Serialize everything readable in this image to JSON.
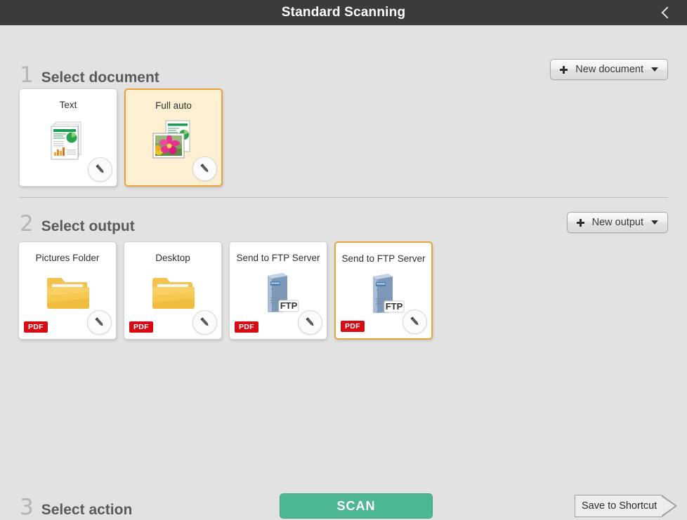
{
  "window": {
    "title": "Standard Scanning",
    "back_icon": "chevron-left-icon"
  },
  "sections": {
    "document": {
      "number": "1",
      "label": "Select document",
      "new_button": {
        "label": "New document",
        "plus_icon": "plus-icon",
        "caret_icon": "chevron-down-icon"
      },
      "cards": [
        {
          "title": "Text",
          "art": "document-stack-icon",
          "selected": false,
          "tinted": false,
          "badge": null
        },
        {
          "title": "Full auto",
          "art": "document-photo-icon",
          "selected": true,
          "tinted": true,
          "badge": null
        }
      ]
    },
    "output": {
      "number": "2",
      "label": "Select output",
      "new_button": {
        "label": "New output",
        "plus_icon": "plus-icon",
        "caret_icon": "chevron-down-icon"
      },
      "cards": [
        {
          "title": "Pictures Folder",
          "art": "folder-icon",
          "selected": false,
          "tinted": false,
          "badge": "PDF"
        },
        {
          "title": "Desktop",
          "art": "folder-icon",
          "selected": false,
          "tinted": false,
          "badge": "PDF"
        },
        {
          "title": "Send to FTP Server",
          "art": "ftp-server-icon",
          "selected": false,
          "tinted": false,
          "badge": "PDF"
        },
        {
          "title": "Send to FTP Server",
          "art": "ftp-server-icon",
          "selected": true,
          "tinted": false,
          "badge": "PDF"
        }
      ]
    },
    "action": {
      "number": "3",
      "label": "Select action",
      "scan_button": "SCAN",
      "shortcut_button": "Save to Shortcut"
    }
  },
  "colors": {
    "titlebar_bg": "#3b3b3b",
    "page_bg": "#e2e2e2",
    "selected_border": "#e8a33d",
    "selected_fill": "#fdf0d2",
    "scan_green": "#4db693",
    "pdf_red": "#d60b14",
    "step_number": "#b4b4b4",
    "step_label": "#5a5a5a"
  },
  "edit_icon": "pencil-icon"
}
